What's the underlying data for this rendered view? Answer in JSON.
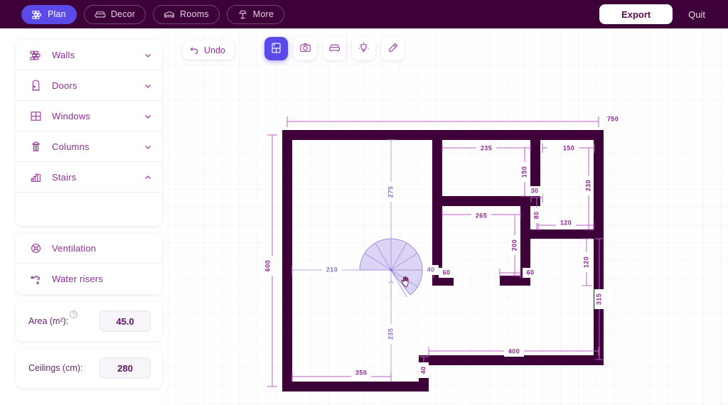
{
  "topbar": {
    "nav": [
      {
        "label": "Plan",
        "icon": "wall-bricks-icon",
        "active": true
      },
      {
        "label": "Decor",
        "icon": "sofa-icon",
        "active": false
      },
      {
        "label": "Rooms",
        "icon": "bed-icon",
        "active": false
      },
      {
        "label": "More",
        "icon": "lamp-icon",
        "active": false
      }
    ],
    "export_label": "Export",
    "quit_label": "Quit",
    "background": "#3d0038",
    "accent": "#5b4ae8"
  },
  "sidebar": {
    "categories": [
      {
        "label": "Walls",
        "icon": "wall-bricks-icon",
        "expanded": false
      },
      {
        "label": "Doors",
        "icon": "door-icon",
        "expanded": false
      },
      {
        "label": "Windows",
        "icon": "window-icon",
        "expanded": false
      },
      {
        "label": "Columns",
        "icon": "column-icon",
        "expanded": false
      },
      {
        "label": "Stairs",
        "icon": "stairs-icon",
        "expanded": true
      }
    ],
    "utilities": [
      {
        "label": "Ventilation",
        "icon": "ventilation-icon"
      },
      {
        "label": "Water risers",
        "icon": "water-tap-icon"
      }
    ],
    "fields": [
      {
        "label": "Area (m²):",
        "value": "45.0",
        "help": "?"
      },
      {
        "label": "Ceilings (cm):",
        "value": "280"
      }
    ]
  },
  "toolbar": {
    "undo_label": "Undo",
    "undo_icon": "undo-arrow-icon",
    "tools": [
      {
        "icon": "floorplan-icon",
        "active": true
      },
      {
        "icon": "camera-icon",
        "active": false
      },
      {
        "icon": "sofa-icon",
        "active": false
      },
      {
        "icon": "lightbulb-icon",
        "active": false
      },
      {
        "icon": "paint-pen-icon",
        "active": false
      }
    ]
  },
  "plan": {
    "wall_color": "#3d0038",
    "dim_color": "#8b2a90",
    "guide_color": "#8e6fc4",
    "stair_fill": "#d7cdf2",
    "stair_stroke": "#9f8ddd",
    "cursor": "grab-hand-cursor",
    "dimensions": {
      "top_overall": "750",
      "left_overall": "600",
      "vert_guide_upper": "275",
      "vert_guide_lower": "235",
      "stair_left": "210",
      "stair_right": "40",
      "bottom_left": "350",
      "bottom_step": "40",
      "bottom_right": "400",
      "room_a_width": "235",
      "room_a_height": "150",
      "room_b_width": "150",
      "room_b_height": "230",
      "room_c_width": "265",
      "room_c_height": "200",
      "gap_30": "30",
      "gap_80": "80",
      "gap_120_upper": "120",
      "gap_120_lower": "120",
      "door_left": "60",
      "door_right": "60",
      "right_lower": "315"
    }
  }
}
